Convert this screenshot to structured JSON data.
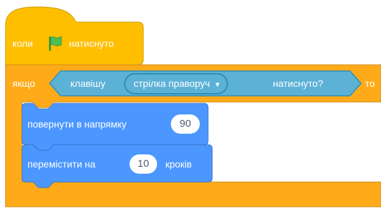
{
  "hat_block": {
    "label_when": "коли",
    "flag_icon": "green-flag-icon",
    "label_clicked": "натиснуто"
  },
  "if_block": {
    "label_if": "якщо",
    "label_then": "то"
  },
  "sensing_block": {
    "label_key": "клавішу",
    "key_value": "стрілка праворуч",
    "label_pressed": "натиснуто?"
  },
  "turn_block": {
    "label": "повернути в напрямку",
    "value": "90"
  },
  "move_block": {
    "label_before": "перемістити на",
    "value": "10",
    "label_after": "кроків"
  },
  "colors": {
    "events": "#ffbf00",
    "control": "#ffab19",
    "sensing": "#5cb1d6",
    "motion": "#4c97ff",
    "flag": "#4cbf56"
  }
}
